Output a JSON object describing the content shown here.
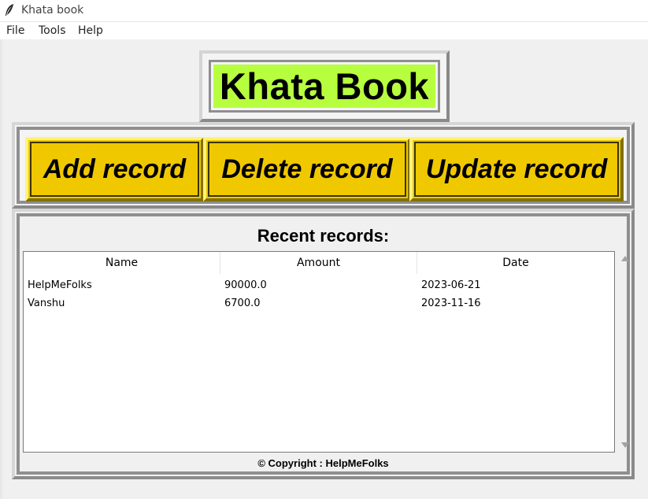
{
  "window": {
    "title": "Khata book"
  },
  "menu": {
    "items": [
      "File",
      "Tools",
      "Help"
    ]
  },
  "header": {
    "title": "Khata Book"
  },
  "actions": {
    "add": "Add record",
    "delete": "Delete record",
    "update": "Update record"
  },
  "records": {
    "heading": "Recent records:",
    "columns": [
      "Name",
      "Amount",
      "Date"
    ],
    "rows": [
      [
        "HelpMeFolks",
        "90000.0",
        "2023-06-21"
      ],
      [
        "Vanshu",
        "6700.0",
        "2023-11-16"
      ]
    ]
  },
  "footer": {
    "copyright": "© Copyright : HelpMeFolks"
  },
  "colors": {
    "title_bg": "#b7ff3e",
    "button_bg": "#f0c800",
    "frame_border": "#8f8f8f"
  }
}
